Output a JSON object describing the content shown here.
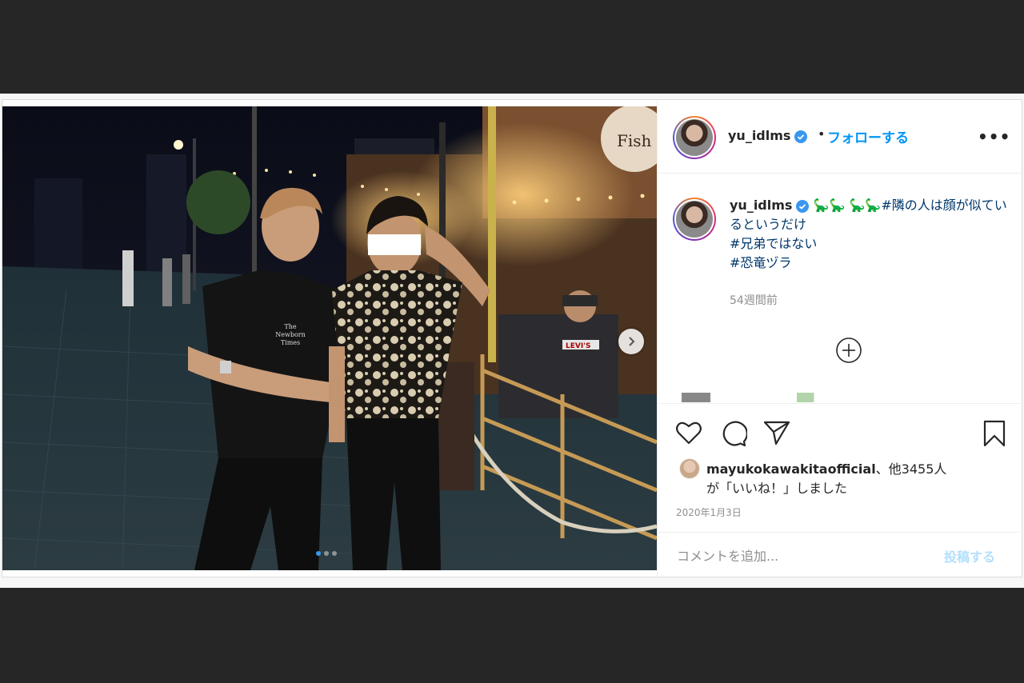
{
  "header": {
    "username": "yu_idlms",
    "bullet": "•",
    "follow_label": "フォローする",
    "more_label": "•••"
  },
  "caption": {
    "username": "yu_idlms",
    "emoji": "🦕🦕 🦕🦕",
    "line1": "#隣の人は顔が似ているというだけ",
    "line2": "#兄弟ではない",
    "line3": "#恐竜ヅラ",
    "time_ago": "54週間前"
  },
  "likes": {
    "user": "mayukokawakitaofficial",
    "others": "、他3455人",
    "line2": "が「いいね！」しました"
  },
  "date": "2020年1月3日",
  "comment_box": {
    "placeholder": "コメントを追加...",
    "post_label": "投稿する"
  },
  "photo": {
    "shirt_text_line1": "The",
    "shirt_text_line2": "Newborn",
    "shirt_text_line3": "Times",
    "tshirt_text": "LEVI'S",
    "sign_text": "Fish",
    "carousel_total": 3,
    "carousel_active": 1
  },
  "colors": {
    "accent": "#0095f6",
    "verified": "#3897f0",
    "hashtag": "#00376b",
    "post_disabled": "#b2dffc"
  }
}
